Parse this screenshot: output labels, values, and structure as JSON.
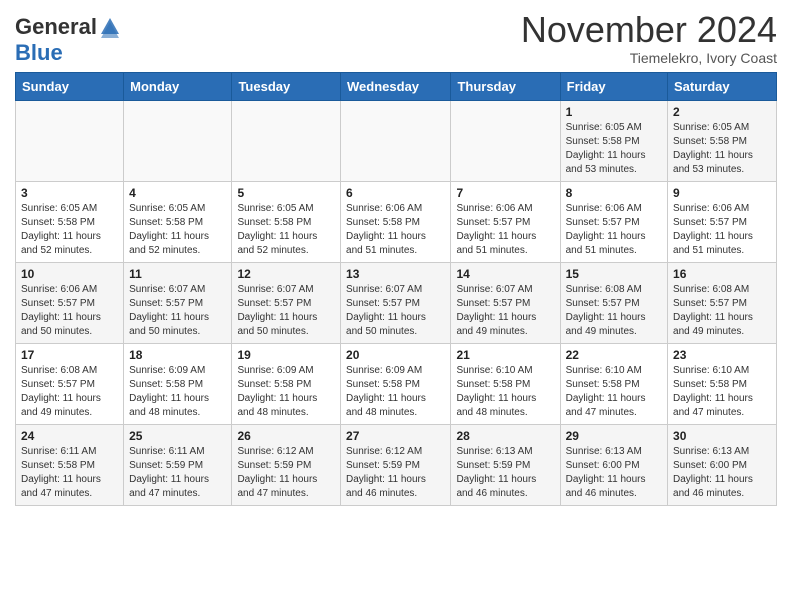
{
  "header": {
    "logo_general": "General",
    "logo_blue": "Blue",
    "month_title": "November 2024",
    "location": "Tiemelekro, Ivory Coast"
  },
  "weekdays": [
    "Sunday",
    "Monday",
    "Tuesday",
    "Wednesday",
    "Thursday",
    "Friday",
    "Saturday"
  ],
  "weeks": [
    [
      {
        "day": "",
        "info": ""
      },
      {
        "day": "",
        "info": ""
      },
      {
        "day": "",
        "info": ""
      },
      {
        "day": "",
        "info": ""
      },
      {
        "day": "",
        "info": ""
      },
      {
        "day": "1",
        "info": "Sunrise: 6:05 AM\nSunset: 5:58 PM\nDaylight: 11 hours\nand 53 minutes."
      },
      {
        "day": "2",
        "info": "Sunrise: 6:05 AM\nSunset: 5:58 PM\nDaylight: 11 hours\nand 53 minutes."
      }
    ],
    [
      {
        "day": "3",
        "info": "Sunrise: 6:05 AM\nSunset: 5:58 PM\nDaylight: 11 hours\nand 52 minutes."
      },
      {
        "day": "4",
        "info": "Sunrise: 6:05 AM\nSunset: 5:58 PM\nDaylight: 11 hours\nand 52 minutes."
      },
      {
        "day": "5",
        "info": "Sunrise: 6:05 AM\nSunset: 5:58 PM\nDaylight: 11 hours\nand 52 minutes."
      },
      {
        "day": "6",
        "info": "Sunrise: 6:06 AM\nSunset: 5:58 PM\nDaylight: 11 hours\nand 51 minutes."
      },
      {
        "day": "7",
        "info": "Sunrise: 6:06 AM\nSunset: 5:57 PM\nDaylight: 11 hours\nand 51 minutes."
      },
      {
        "day": "8",
        "info": "Sunrise: 6:06 AM\nSunset: 5:57 PM\nDaylight: 11 hours\nand 51 minutes."
      },
      {
        "day": "9",
        "info": "Sunrise: 6:06 AM\nSunset: 5:57 PM\nDaylight: 11 hours\nand 51 minutes."
      }
    ],
    [
      {
        "day": "10",
        "info": "Sunrise: 6:06 AM\nSunset: 5:57 PM\nDaylight: 11 hours\nand 50 minutes."
      },
      {
        "day": "11",
        "info": "Sunrise: 6:07 AM\nSunset: 5:57 PM\nDaylight: 11 hours\nand 50 minutes."
      },
      {
        "day": "12",
        "info": "Sunrise: 6:07 AM\nSunset: 5:57 PM\nDaylight: 11 hours\nand 50 minutes."
      },
      {
        "day": "13",
        "info": "Sunrise: 6:07 AM\nSunset: 5:57 PM\nDaylight: 11 hours\nand 50 minutes."
      },
      {
        "day": "14",
        "info": "Sunrise: 6:07 AM\nSunset: 5:57 PM\nDaylight: 11 hours\nand 49 minutes."
      },
      {
        "day": "15",
        "info": "Sunrise: 6:08 AM\nSunset: 5:57 PM\nDaylight: 11 hours\nand 49 minutes."
      },
      {
        "day": "16",
        "info": "Sunrise: 6:08 AM\nSunset: 5:57 PM\nDaylight: 11 hours\nand 49 minutes."
      }
    ],
    [
      {
        "day": "17",
        "info": "Sunrise: 6:08 AM\nSunset: 5:57 PM\nDaylight: 11 hours\nand 49 minutes."
      },
      {
        "day": "18",
        "info": "Sunrise: 6:09 AM\nSunset: 5:58 PM\nDaylight: 11 hours\nand 48 minutes."
      },
      {
        "day": "19",
        "info": "Sunrise: 6:09 AM\nSunset: 5:58 PM\nDaylight: 11 hours\nand 48 minutes."
      },
      {
        "day": "20",
        "info": "Sunrise: 6:09 AM\nSunset: 5:58 PM\nDaylight: 11 hours\nand 48 minutes."
      },
      {
        "day": "21",
        "info": "Sunrise: 6:10 AM\nSunset: 5:58 PM\nDaylight: 11 hours\nand 48 minutes."
      },
      {
        "day": "22",
        "info": "Sunrise: 6:10 AM\nSunset: 5:58 PM\nDaylight: 11 hours\nand 47 minutes."
      },
      {
        "day": "23",
        "info": "Sunrise: 6:10 AM\nSunset: 5:58 PM\nDaylight: 11 hours\nand 47 minutes."
      }
    ],
    [
      {
        "day": "24",
        "info": "Sunrise: 6:11 AM\nSunset: 5:58 PM\nDaylight: 11 hours\nand 47 minutes."
      },
      {
        "day": "25",
        "info": "Sunrise: 6:11 AM\nSunset: 5:59 PM\nDaylight: 11 hours\nand 47 minutes."
      },
      {
        "day": "26",
        "info": "Sunrise: 6:12 AM\nSunset: 5:59 PM\nDaylight: 11 hours\nand 47 minutes."
      },
      {
        "day": "27",
        "info": "Sunrise: 6:12 AM\nSunset: 5:59 PM\nDaylight: 11 hours\nand 46 minutes."
      },
      {
        "day": "28",
        "info": "Sunrise: 6:13 AM\nSunset: 5:59 PM\nDaylight: 11 hours\nand 46 minutes."
      },
      {
        "day": "29",
        "info": "Sunrise: 6:13 AM\nSunset: 6:00 PM\nDaylight: 11 hours\nand 46 minutes."
      },
      {
        "day": "30",
        "info": "Sunrise: 6:13 AM\nSunset: 6:00 PM\nDaylight: 11 hours\nand 46 minutes."
      }
    ]
  ]
}
